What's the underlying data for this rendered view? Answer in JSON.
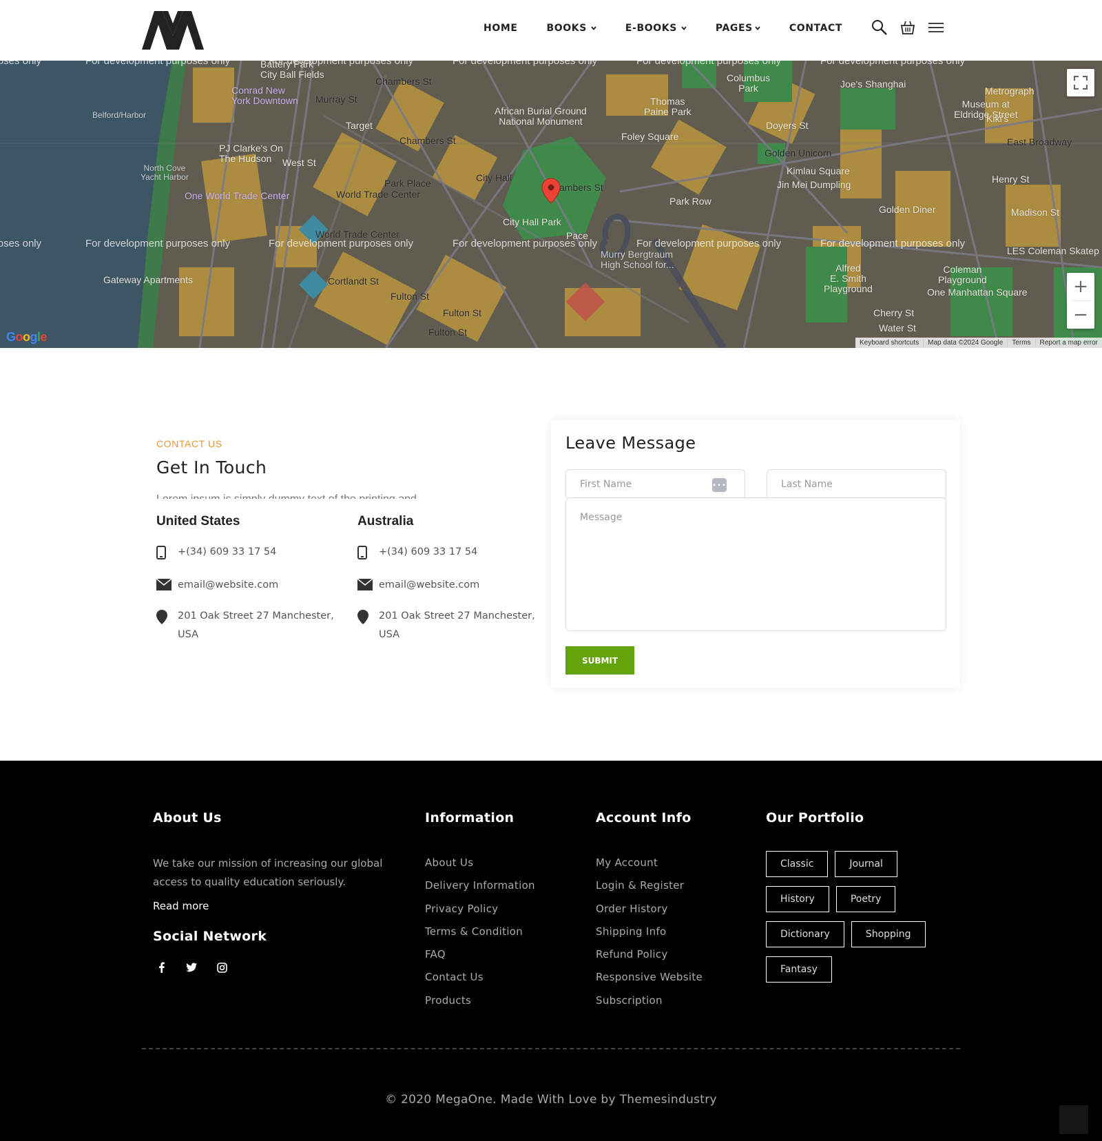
{
  "header": {
    "nav": [
      {
        "label": "HOME",
        "dropdown": false
      },
      {
        "label": "BOOKS",
        "dropdown": true
      },
      {
        "label": "E-BOOKS",
        "dropdown": true
      },
      {
        "label": "PAGES",
        "dropdown": true
      },
      {
        "label": "CONTACT",
        "dropdown": false
      }
    ],
    "icons": [
      "search-icon",
      "cart-icon",
      "menu-icon"
    ]
  },
  "map": {
    "watermark": "For development purposes only",
    "labels": {
      "chambers_st_1": "Chambers St",
      "chambers_st_2": "Chambers St",
      "chambers_st_3": "ambers St",
      "conrad": "Conrad New\nYork Downtown",
      "murray": "Murray St",
      "target": "Target",
      "african": "African Burial Ground\nNational Monument",
      "thomas": "Thomas\nPaine Park",
      "foley": "Foley Square",
      "columbus": "Columbus\nPark",
      "joes": "Joe's Shanghai",
      "metrograph": "Metrograph",
      "museum": "Museum at\nEldridge Street",
      "kikis": "Kiki's",
      "east_broadway": "East Broadway",
      "doyers": "Doyers St",
      "golden_unicorn": "Golden Unicorn",
      "kimlau": "Kimlau Square",
      "jin_mei": "Jin Mei Dumpling",
      "henry": "Henry St",
      "madison": "Madison St",
      "golden_diner": "Golden Diner",
      "city_hall": "City Hall",
      "city_hall_park": "City Hall Park",
      "park_place": "Park Place",
      "wtc": "World Trade Center",
      "wtc2": "World Trade Center",
      "one_wtc": "One World Trade Center",
      "pj_clarke": "PJ Clarke's On\nThe Hudson",
      "north_cove": "North Cove\nYacht Harbor",
      "belford": "Belford/Harbor",
      "battery": "Battery Park\nCity Ball Fields",
      "cortlandt": "Cortlandt St",
      "fulton1": "Fulton St",
      "fulton2": "Fulton St",
      "fulton3": "Fulton St",
      "gateway": "Gateway Apartments",
      "alfred": "Alfred\nE. Smith\nPlayground",
      "coleman": "Coleman\nPlayground",
      "one_manhattan": "One Manhattan Square",
      "cherry": "Cherry St",
      "water": "Water St",
      "murry": "Murry Bergtraum\nHigh School for...",
      "park_row": "Park Row",
      "pace": "Pace",
      "west_st": "West St",
      "les": "LES Coleman Skatep"
    },
    "attribution": [
      "Keyboard shortcuts",
      "Map data ©2024 Google",
      "Terms",
      "Report a map error"
    ],
    "google": "Google",
    "controls": {
      "zoom_in": "+",
      "zoom_out": "−"
    }
  },
  "contact": {
    "eyebrow": "CONTACT US",
    "title": "Get In Touch",
    "lorem": "Lorem ipsum is simply dummy text of the printing and",
    "offices": [
      {
        "name": "United States",
        "phone": "+(34) 609 33 17 54",
        "email": "email@website.com",
        "address": "201 Oak Street 27 Manchester, USA"
      },
      {
        "name": "Australia",
        "phone": "+(34) 609 33 17 54",
        "email": "email@website.com",
        "address": "201 Oak Street 27 Manchester, USA"
      }
    ]
  },
  "form": {
    "title": "Leave Message",
    "first_name_placeholder": "First Name",
    "last_name_placeholder": "Last Name",
    "message_placeholder": "Message",
    "submit_label": "SUBMIT"
  },
  "footer": {
    "about_title": "About Us",
    "about_text": "We take our mission of increasing our global access to quality education seriously.",
    "read_more": "Read more",
    "social_title": "Social Network",
    "social_icons": [
      "facebook-icon",
      "twitter-icon",
      "instagram-icon"
    ],
    "information_title": "Information",
    "information_links": [
      "About Us",
      "Delivery Information",
      "Privacy Policy",
      "Terms & Condition",
      "FAQ",
      "Contact Us",
      "Products"
    ],
    "account_title": "Account Info",
    "account_links": [
      "My Account",
      "Login & Register",
      "Order History",
      "Shipping Info",
      "Refund Policy",
      "Responsive Website",
      "Subscription"
    ],
    "portfolio_title": "Our Portfolio",
    "portfolio_tags": [
      "Classic",
      "Journal",
      "History",
      "Poetry",
      "Dictionary",
      "Shopping",
      "Fantasy"
    ],
    "copyright": "© 2020 MegaOne. Made With Love by Themesindustry"
  },
  "colors": {
    "accent_orange": "#e8962a",
    "submit_green": "#62a40a",
    "footer_bg": "#000000"
  }
}
